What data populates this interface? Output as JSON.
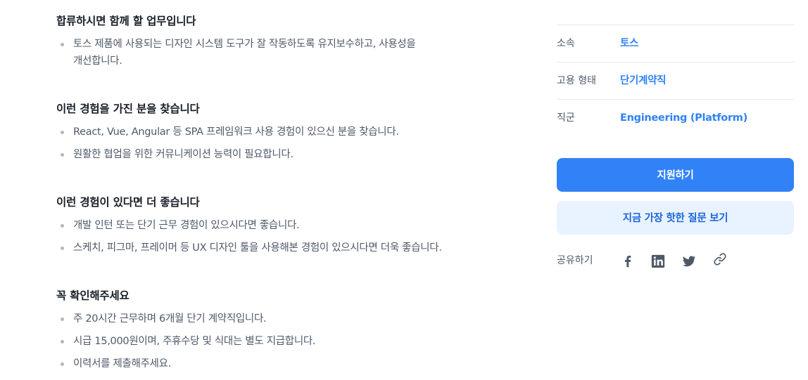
{
  "sections": [
    {
      "title": "합류하시면 함께 할 업무입니다",
      "items": [
        "토스 제품에 사용되는 디자인 시스템 도구가 잘 작동하도록 유지보수하고, 사용성을",
        "개선합니다."
      ]
    },
    {
      "title": "이런 경험을 가진 분을 찾습니다",
      "items": [
        "React, Vue, Angular 등 SPA 프레임워크 사용 경험이 있으신 분을 찾습니다.",
        "원활한 협업을 위한 커뮤니케이션 능력이 필요합니다."
      ]
    },
    {
      "title": "이런 경험이 있다면 더 좋습니다",
      "items": [
        "개발 인턴 또는 단기 근무 경험이 있으시다면 좋습니다.",
        "스케치, 피그마, 프레이머 등 UX 디자인 툴을 사용해본 경험이 있으시다면 더욱 좋습니다."
      ]
    },
    {
      "title": "꼭 확인해주세요",
      "items": [
        "주 20시간 근무하며 6개월 단기 계약직입니다.",
        "시급 15,000원이며, 주휴수당 및 식대는 별도 지급합니다.",
        "이력서를 제출해주세요."
      ]
    }
  ],
  "sidebar": {
    "info": [
      {
        "label": "소속",
        "value": "토스"
      },
      {
        "label": "고용 형태",
        "value": "단기계약직"
      },
      {
        "label": "직군",
        "value": "Engineering (Platform)"
      }
    ],
    "apply_label": "지원하기",
    "faq_label": "지금 가장 핫한 질문 보기",
    "share_label": "공유하기",
    "share_icons": [
      "facebook-icon",
      "linkedin-icon",
      "twitter-icon",
      "link-icon"
    ]
  },
  "colors": {
    "accent": "#3182f6",
    "accent_light": "#e8f3ff",
    "heading": "#191f28",
    "body_text": "#4e5968",
    "bullet": "#b0b8c1",
    "icon": "#4e5968"
  }
}
